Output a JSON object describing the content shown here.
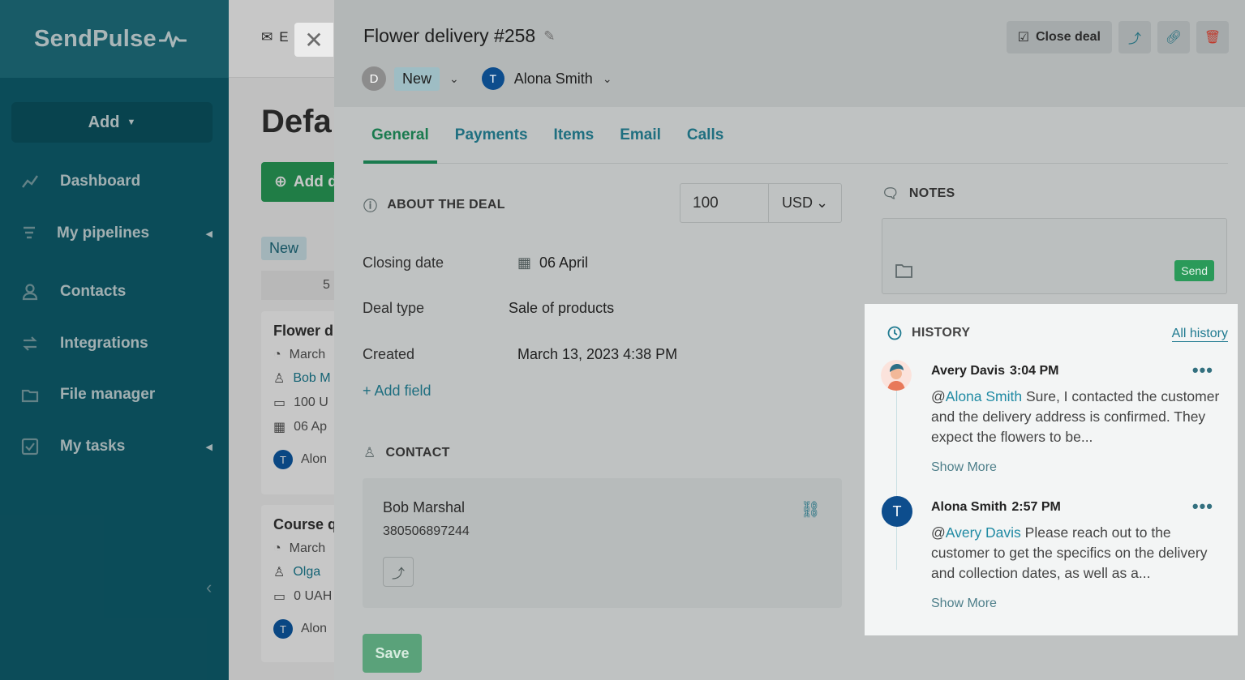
{
  "sidebar": {
    "logo": "SendPulse",
    "add_label": "Add",
    "items": [
      {
        "label": "Dashboard",
        "icon": "dashboard-chart-icon"
      },
      {
        "label": "My pipelines",
        "icon": "pipelines-icon",
        "has_arrow": true
      },
      {
        "label": "Contacts",
        "icon": "contacts-icon"
      },
      {
        "label": "Integrations",
        "icon": "integrations-icon"
      },
      {
        "label": "File manager",
        "icon": "folder-icon"
      },
      {
        "label": "My tasks",
        "icon": "tasks-icon",
        "has_arrow": true
      }
    ]
  },
  "background": {
    "email_label": "E",
    "title": "Defa",
    "add_button": "Add d",
    "stage": "New",
    "count": "5",
    "cards": [
      {
        "title": "Flower d",
        "date": "March",
        "contact": "Bob M",
        "amount": "100 U",
        "due": "06 Ap",
        "avatar": "T",
        "owner": "Alon"
      },
      {
        "title": "Course q",
        "date": "March",
        "contact": "Olga",
        "amount": "0 UAH",
        "avatar": "T",
        "owner": "Alon"
      }
    ]
  },
  "deal": {
    "title": "Flower delivery #258",
    "stage_initial": "D",
    "stage": "New",
    "owner_initial": "T",
    "owner": "Alona Smith",
    "close_deal_label": "Close deal",
    "tabs": [
      "General",
      "Payments",
      "Items",
      "Email",
      "Calls"
    ],
    "active_tab": "General",
    "about_title": "ABOUT THE DEAL",
    "amount": "100",
    "currency": "USD",
    "fields": [
      {
        "label": "Closing date",
        "value": "06 April"
      },
      {
        "label": "Deal type",
        "value": "Sale of products"
      },
      {
        "label": "Created",
        "value": "March 13, 2023 4:38 PM"
      }
    ],
    "add_field_label": "+ Add field",
    "contact_title": "CONTACT",
    "contact": {
      "name": "Bob Marshal",
      "phone": "380506897244"
    },
    "save_label": "Save",
    "notes_title": "NOTES",
    "send_label": "Send"
  },
  "history": {
    "title": "HISTORY",
    "all_link": "All history",
    "entries": [
      {
        "author": "Avery Davis",
        "time": "3:04 PM",
        "mention": "@Alona Smith",
        "mention_prefix": "@",
        "mention_name": "Alona Smith",
        "text": " Sure, I contacted the customer and the delivery address is confirmed. They expect the flowers to be...",
        "more": "Show More"
      },
      {
        "author": "Alona Smith",
        "avatar": "T",
        "time": "2:57 PM",
        "mention_prefix": "@",
        "mention_name": "Avery Davis",
        "text": " Please reach out to the customer to get the specifics on the delivery and collection dates, as well as a...",
        "more": "Show More"
      }
    ]
  },
  "colors": {
    "sidebar": "#0f6272",
    "accent_green": "#1a7b4f",
    "link": "#1f8aa3",
    "history_bg": "#f3f5f5"
  }
}
